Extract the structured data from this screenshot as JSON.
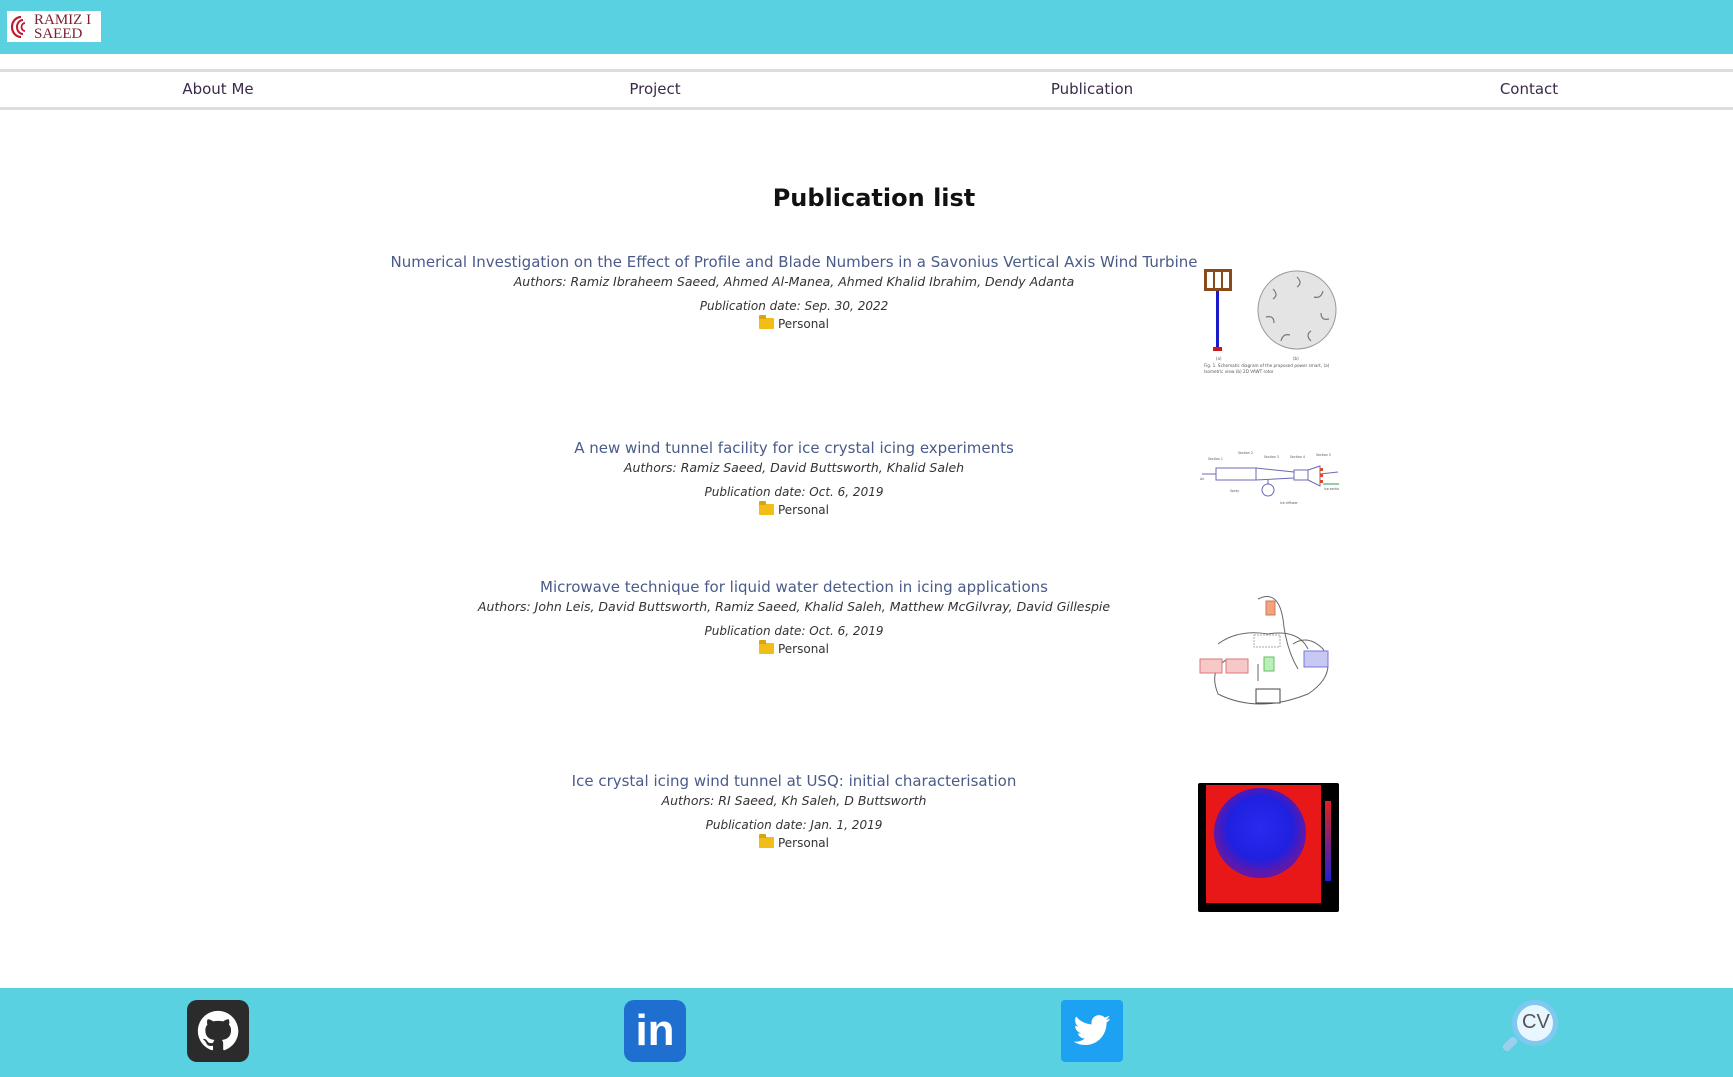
{
  "header": {
    "logo_line1": "RAMIZ I",
    "logo_line2": "SAEED"
  },
  "nav": {
    "items": [
      {
        "label": "About Me"
      },
      {
        "label": "Project"
      },
      {
        "label": "Publication"
      },
      {
        "label": "Contact"
      }
    ]
  },
  "main": {
    "title": "Publication list",
    "publications": [
      {
        "title": "Numerical Investigation on the Effect of Profile and Blade Numbers in a Savonius Vertical Axis Wind Turbine",
        "authors": "Authors: Ramiz Ibraheem Saeed, Ahmed Al-Manea, Ahmed Khalid Ibrahim, Dendy Adanta",
        "date": "Publication date: Sep. 30, 2022",
        "category": "Personal",
        "thumb_caption": "Fig. 1. Schematic diagram of the proposed power smart, (a) Isometric view (b) 2D VAWT rotor"
      },
      {
        "title": "A new wind tunnel facility for ice crystal icing experiments",
        "authors": "Authors: Ramiz Saeed, David Buttsworth, Khalid Saleh",
        "date": "Publication date: Oct. 6, 2019",
        "category": "Personal"
      },
      {
        "title": "Microwave technique for liquid water detection in icing applications",
        "authors": "Authors: John Leis, David Buttsworth, Ramiz Saeed, Khalid Saleh, Matthew McGilvray, David Gillespie",
        "date": "Publication date: Oct. 6, 2019",
        "category": "Personal"
      },
      {
        "title": "Ice crystal icing wind tunnel at USQ: initial characterisation",
        "authors": "Authors: RI Saeed, Kh Saleh, D Buttsworth",
        "date": "Publication date: Jan. 1, 2019",
        "category": "Personal"
      }
    ]
  },
  "footer": {
    "links": [
      {
        "icon": "github-icon"
      },
      {
        "icon": "linkedin-icon",
        "text": "in"
      },
      {
        "icon": "twitter-icon"
      },
      {
        "icon": "cv-icon",
        "text": "CV"
      }
    ]
  },
  "colors": {
    "accent": "#5ad1e1",
    "title_link": "#4a5b8a",
    "nav_text": "#3b2a4a"
  }
}
